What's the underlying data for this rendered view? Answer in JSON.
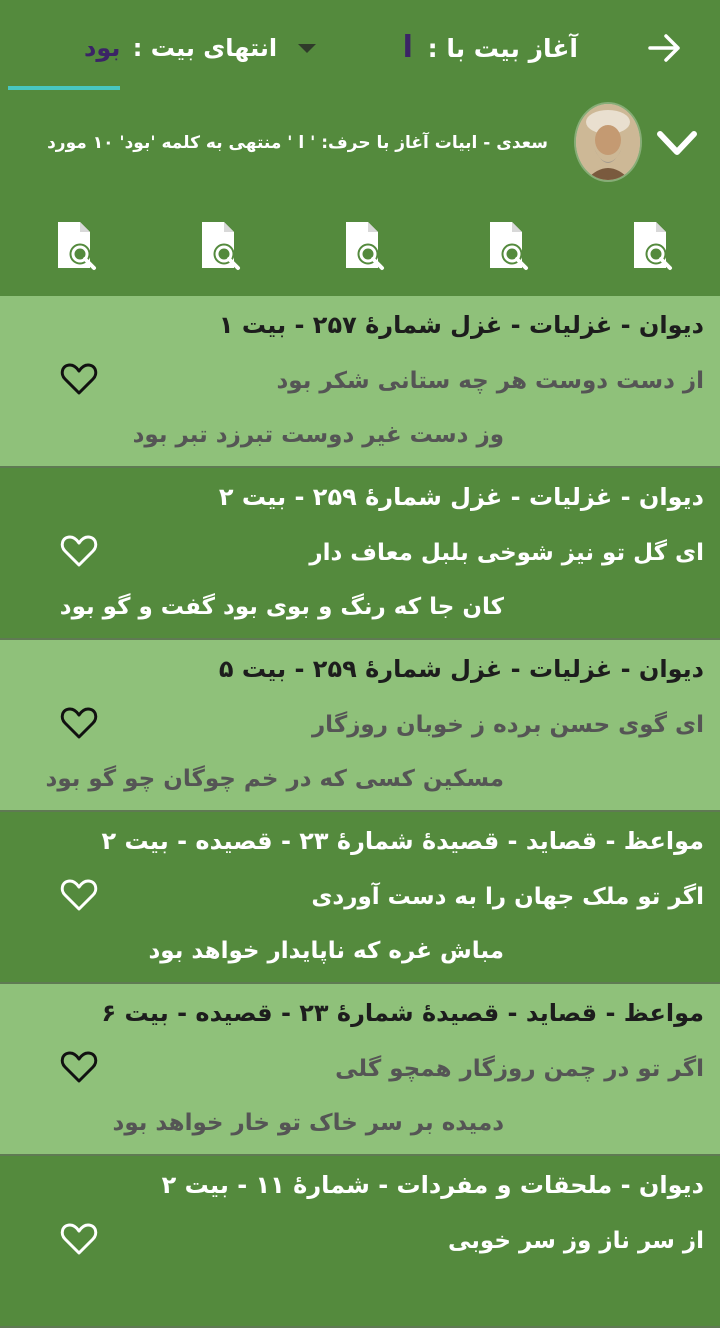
{
  "header": {
    "start_label": "آغاز بیت با :",
    "start_value": "ا",
    "end_label": "انتهای بیت :",
    "end_value": "بود"
  },
  "info": {
    "text": "سعدی - ابیات  آغاز با حرف: ' ا '  منتهی به کلمه 'بود' ۱۰ مورد"
  },
  "toolbar": {
    "icons": [
      "search-document-icon",
      "search-document-icon",
      "search-document-icon",
      "search-document-icon",
      "search-document-icon"
    ]
  },
  "colors": {
    "dark_green": "#548a3d",
    "light_green": "#8fc17a",
    "accent_underline": "#48c7c1",
    "value_purple": "#3b2466"
  },
  "results": [
    {
      "title": "دیوان - غزلیات - غزل شمارهٔ  ۲۵۷ - بیت ۱",
      "line1": "از دست دوست هر چه ستانی شکر بود",
      "line2": "وز دست غیر دوست تبرزد تبر بود"
    },
    {
      "title": "دیوان - غزلیات - غزل شمارهٔ  ۲۵۹ - بیت ۲",
      "line1": "ای گل تو نیز شوخی بلبل معاف دار",
      "line2": "کان جا که رنگ و بوی بود گفت و گو بود"
    },
    {
      "title": "دیوان - غزلیات - غزل شمارهٔ  ۲۵۹ - بیت ۵",
      "line1": "ای گوی حسن برده ز خوبان روزگار",
      "line2": "مسکین کسی که در خم چوگان چو گو بود"
    },
    {
      "title": "مواعظ - قصاید - قصیدهٔ شمارهٔ ۲۳ - قصیده - بیت ۲",
      "line1": "اگر تو ملک جهان را به دست آوردی",
      "line2": "مباش غره که ناپایدار خواهد بود"
    },
    {
      "title": "مواعظ - قصاید - قصیدهٔ شمارهٔ ۲۳ - قصیده - بیت ۶",
      "line1": "اگر تو در چمن روزگار همچو گلی",
      "line2": "دمیده بر سر خاک تو خار خواهد بود"
    },
    {
      "title": "دیوان - ملحقات و مفردات - شمارهٔ  ۱۱ - بیت ۲",
      "line1": "از سر ناز وز سر خوبی",
      "line2": ""
    }
  ]
}
